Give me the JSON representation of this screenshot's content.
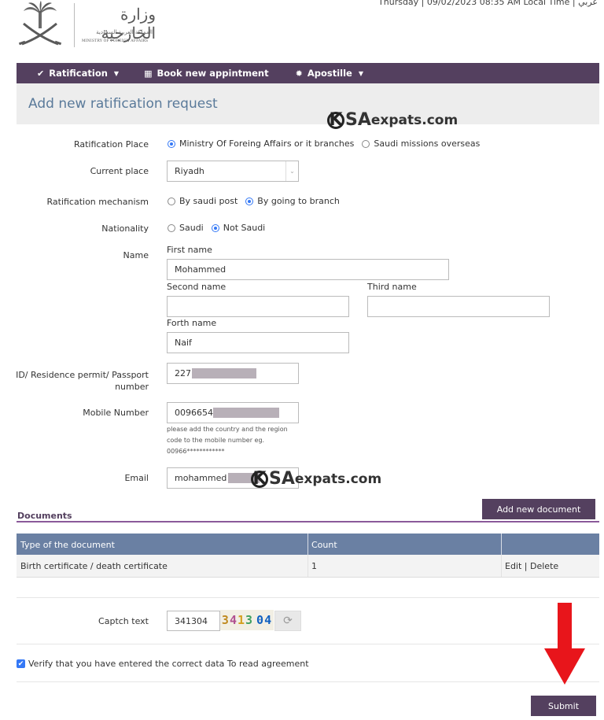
{
  "header": {
    "datetime": "Thursday | 09/02/2023 08:35 AM Local Time | عربي",
    "ministry_ar": "وزارة الخارجية",
    "kingdom_ar": "المملكة العربية السعودية",
    "ministry_en": "MINISTRY OF FOREIGN AFFAIRS"
  },
  "nav": {
    "ratification": "Ratification",
    "book": "Book new appintment",
    "apostille": "Apostille"
  },
  "page_title": "Add new ratification request",
  "watermark": {
    "k": "K",
    "sa": "SA",
    "rest": "expats.com"
  },
  "form": {
    "ratification_place": {
      "label": "Ratification Place",
      "options": [
        "Ministry Of Foreing Affairs or it branches",
        "Saudi missions overseas"
      ]
    },
    "current_place": {
      "label": "Current place",
      "value": "Riyadh"
    },
    "mechanism": {
      "label": "Ratification mechanism",
      "options": [
        "By saudi post",
        "By going to branch"
      ]
    },
    "nationality": {
      "label": "Nationality",
      "options": [
        "Saudi",
        "Not Saudi"
      ]
    },
    "name": {
      "label": "Name",
      "first_label": "First name",
      "first_value": "Mohammed",
      "second_label": "Second name",
      "second_value": "",
      "third_label": "Third name",
      "third_value": "",
      "forth_label": "Forth name",
      "forth_value": "Naif"
    },
    "id": {
      "label_line1": "ID/ Residence permit/ Passport",
      "label_line2": "number",
      "value": "227"
    },
    "mobile": {
      "label": "Mobile Number",
      "value": "0096654",
      "hint": "please add the country and the region code to the mobile number eg. 00966************"
    },
    "email": {
      "label": "Email",
      "value": "mohammed"
    }
  },
  "documents": {
    "title": "Documents",
    "add_button": "Add new document",
    "columns": [
      "Type of the document",
      "Count",
      ""
    ],
    "rows": [
      {
        "type": "Birth certificate / death certificate",
        "count": "1",
        "actions": "Edit | Delete"
      }
    ]
  },
  "captcha": {
    "label": "Captch text",
    "value": "341304",
    "image_text": "341304"
  },
  "agreement": "Verify that you have entered the correct data To read agreement",
  "submit": "Submit",
  "colors": {
    "nav": "#54405f",
    "title": "#5a7a9a",
    "table_head": "#6a80a3",
    "arrow": "#e8151b"
  }
}
